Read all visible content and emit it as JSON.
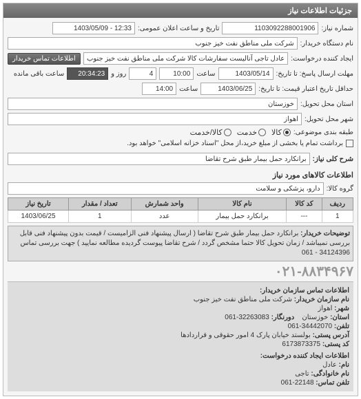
{
  "header": {
    "title": "جزئیات اطلاعات نیاز"
  },
  "fields": {
    "request_no_label": "شماره نیاز:",
    "request_no": "1103092288001906",
    "announce_label": "تاریخ و ساعت اعلان عمومی:",
    "announce": "12:33 - 1403/05/09",
    "org_label": "نام دستگاه خریدار:",
    "org": "شرکت ملی مناطق نفت خیز جنوب",
    "creator_label": "ایجاد کننده درخواست:",
    "creator": "عادل  تاجی آنالیست سفارشات کالا   شرکت ملی مناطق نفت خیز جنوب",
    "contact_btn": "اطلاعات تماس خریدار",
    "deadline_label": "مهلت ارسال پاسخ: تا تاریخ:",
    "deadline_date": "1403/05/14",
    "deadline_time_label": "ساعت",
    "deadline_time": "10:00",
    "days": "4",
    "days_label": "روز و",
    "remain": "20:34:23",
    "remain_label": "ساعت باقی مانده",
    "validity_label": "حداقل تاریخ اعتبار قیمت: تا تاریخ:",
    "validity_date": "1403/06/25",
    "validity_time_label": "ساعت",
    "validity_time": "14:00",
    "province_label": "استان محل تحویل:",
    "province": "خوزستان",
    "city_label": "شهر محل تحویل:",
    "city": "اهواز",
    "category_label": "طبقه بندی موضوعی:",
    "radio_goods": "کالا",
    "radio_service": "خدمت",
    "radio_both": "کالا/خدمت",
    "note1": "برداشت تمام یا بخشی از مبلغ خرید،از محل \"اسناد خزانه اسلامی\" خواهد بود.",
    "desc_label": "شرح کلی نیاز:",
    "desc": "برانکارد حمل بیمار طبق شرح تقاضا"
  },
  "goods_section": {
    "title": "اطلاعات کالاهای مورد نیاز",
    "group_label": "گروه کالا:",
    "group": "دارو، پزشکی و سلامت"
  },
  "table": {
    "headers": [
      "ردیف",
      "کد کالا",
      "نام کالا",
      "واحد شمارش",
      "تعداد / مقدار",
      "تاریخ نیاز"
    ],
    "row": [
      "1",
      "---",
      "برانکارد حمل بیمار",
      "عدد",
      "1",
      "1403/06/25"
    ]
  },
  "buyer_note": {
    "label": "توضیحات خریدار:",
    "text": "برانکارد حمل بیمار طبق شرح تقاضا ( ارسال پیشنهاد فنی الزامیست / قیمت بدون پیشنهاد فنی قابل بررسی نمیباشد / زمان تحویل کالا حتما مشخص گردد / شرح تقاضا پیوست گردیده مطالعه نمایید ) جهت بررسی تماس 34124396 - 061"
  },
  "phone": "۰۲۱-۸۸۳۴۹۶۷",
  "contact": {
    "title": "اطلاعات تماس سازمان خریدار:",
    "org_label": "نام سازمان خریدار:",
    "org": "شرکت ملی مناطق نفت خیز جنوب",
    "city_label": "شهر:",
    "city": "اهواز",
    "province_label": "استان:",
    "province": "خوزستان",
    "fax_label": "دورنگار:",
    "fax": "32263083-061",
    "phone_label": "تلفن:",
    "phone": "34442070-061",
    "address_label": "آدرس پستی:",
    "address": "بولستد خیابان پارک 4 امور حقوقی و قراردادها",
    "postal_label": "کد پستی:",
    "postal": "6173873375"
  },
  "creator_contact": {
    "title": "اطلاعات ایجاد کننده درخواست:",
    "name_label": "نام:",
    "name": "عادل",
    "family_label": "نام خانوادگی:",
    "family": "تاجی",
    "phone_label": "تلفن تماس:",
    "phone": "22148-061"
  }
}
